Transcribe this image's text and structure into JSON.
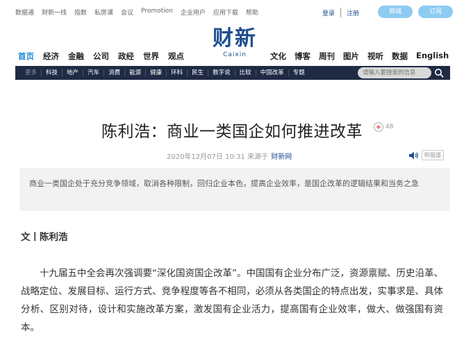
{
  "topbar": {
    "links": [
      "数据通",
      "财新一线",
      "指数",
      "私房课",
      "会议",
      "Promotion",
      "企业用户",
      "应用下载",
      "帮助"
    ],
    "login": "登录",
    "register": "注册",
    "mall": "商城",
    "subscribe": "订阅"
  },
  "logo": {
    "cn": "财新",
    "en": "Caixin"
  },
  "mainnav": {
    "left": [
      "首页",
      "经济",
      "金融",
      "公司",
      "政经",
      "世界",
      "观点"
    ],
    "right": [
      "文化",
      "博客",
      "周刊",
      "图片",
      "视听",
      "数据",
      "English"
    ]
  },
  "subnav": {
    "items": [
      "更多",
      "科技",
      "地产",
      "汽车",
      "消费",
      "能源",
      "健康",
      "环科",
      "民生",
      "数字说",
      "比较",
      "中国改革",
      "专题"
    ],
    "search_placeholder": "请输入要搜索的信息"
  },
  "article": {
    "title": "陈利浩：商业一类国企如何推进改革",
    "comment_count": "48",
    "date": "2020年12月07日 10:31 来源于",
    "source": "财新网",
    "listen": "听报道",
    "summary": "商业一类国企处于充分竞争领域，取消各种限制，回归企业本色，提高企业效率，是国企改革的逻辑结果和当务之急",
    "author": "文丨陈利浩",
    "paragraph": "十九届五中全会再次强调要“深化国资国企改革”。中国国有企业分布广泛，资源禀赋、历史沿革、战略定位、发展目标、运行方式、竞争程度等各不相同，必须从各类国企的特点出发，实事求是、具体分析、区别对待，设计和实施改革方案，激发国有企业活力，提高国有企业效率，做大、做强国有资本。"
  },
  "colors": {
    "brand": "#1e4f8f",
    "accent": "#1e88d2",
    "pill": "#8ecbf1",
    "subnav_bg": "#1f2a44"
  },
  "icons": {
    "search": "search-icon",
    "comment": "comment-icon",
    "speaker": "speaker-icon"
  }
}
